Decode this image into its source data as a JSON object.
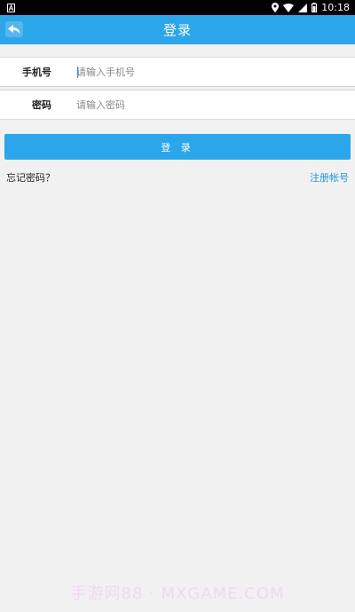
{
  "status_bar": {
    "time": "10:18",
    "icons": [
      "notification-a-icon",
      "location-icon",
      "wifi-icon",
      "signal-icon",
      "battery-icon"
    ]
  },
  "app_bar": {
    "title": "登录",
    "back_icon": "back-arrow-icon",
    "color": "#2ba6ea"
  },
  "form": {
    "phone_label": "手机号",
    "phone_placeholder": "请输入手机号",
    "phone_value": "",
    "password_label": "密码",
    "password_placeholder": "请输入密码",
    "password_value": ""
  },
  "actions": {
    "login_label": "登 录",
    "forgot_label": "忘记密码？",
    "register_label": "注册帐号"
  },
  "watermark": "手游网88 · MXGAME.COM"
}
